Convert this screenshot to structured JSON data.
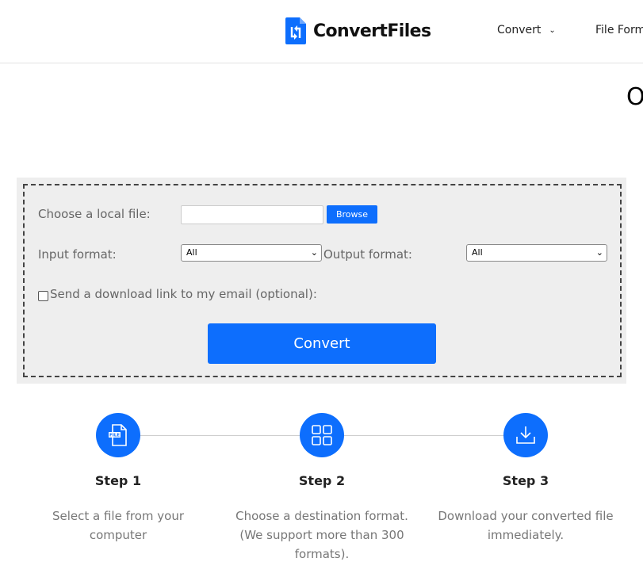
{
  "header": {
    "brand": "ConvertFiles",
    "nav": [
      {
        "label": "Convert",
        "has_dropdown": true
      },
      {
        "label": "File Form"
      }
    ]
  },
  "page_title_fragment": "O",
  "form": {
    "file_label": "Choose a local file:",
    "file_value": "",
    "browse_label": "Browse",
    "input_format_label": "Input format:",
    "input_format_value": "All",
    "output_format_label": "Output format:",
    "output_format_value": "All",
    "email_checkbox_label": "Send a download link to my email (optional):",
    "email_checked": false,
    "convert_label": "Convert"
  },
  "steps": [
    {
      "title": "Step 1",
      "description": "Select a file from your computer",
      "icon": "file-icon"
    },
    {
      "title": "Step 2",
      "description": "Choose a destination format. (We support more than 300 formats).",
      "icon": "grid-icon"
    },
    {
      "title": "Step 3",
      "description": "Download your converted file immediately.",
      "icon": "download-icon"
    }
  ],
  "colors": {
    "accent": "#0d6efd",
    "panel_bg": "#eeeeee",
    "muted_text": "#777777"
  }
}
